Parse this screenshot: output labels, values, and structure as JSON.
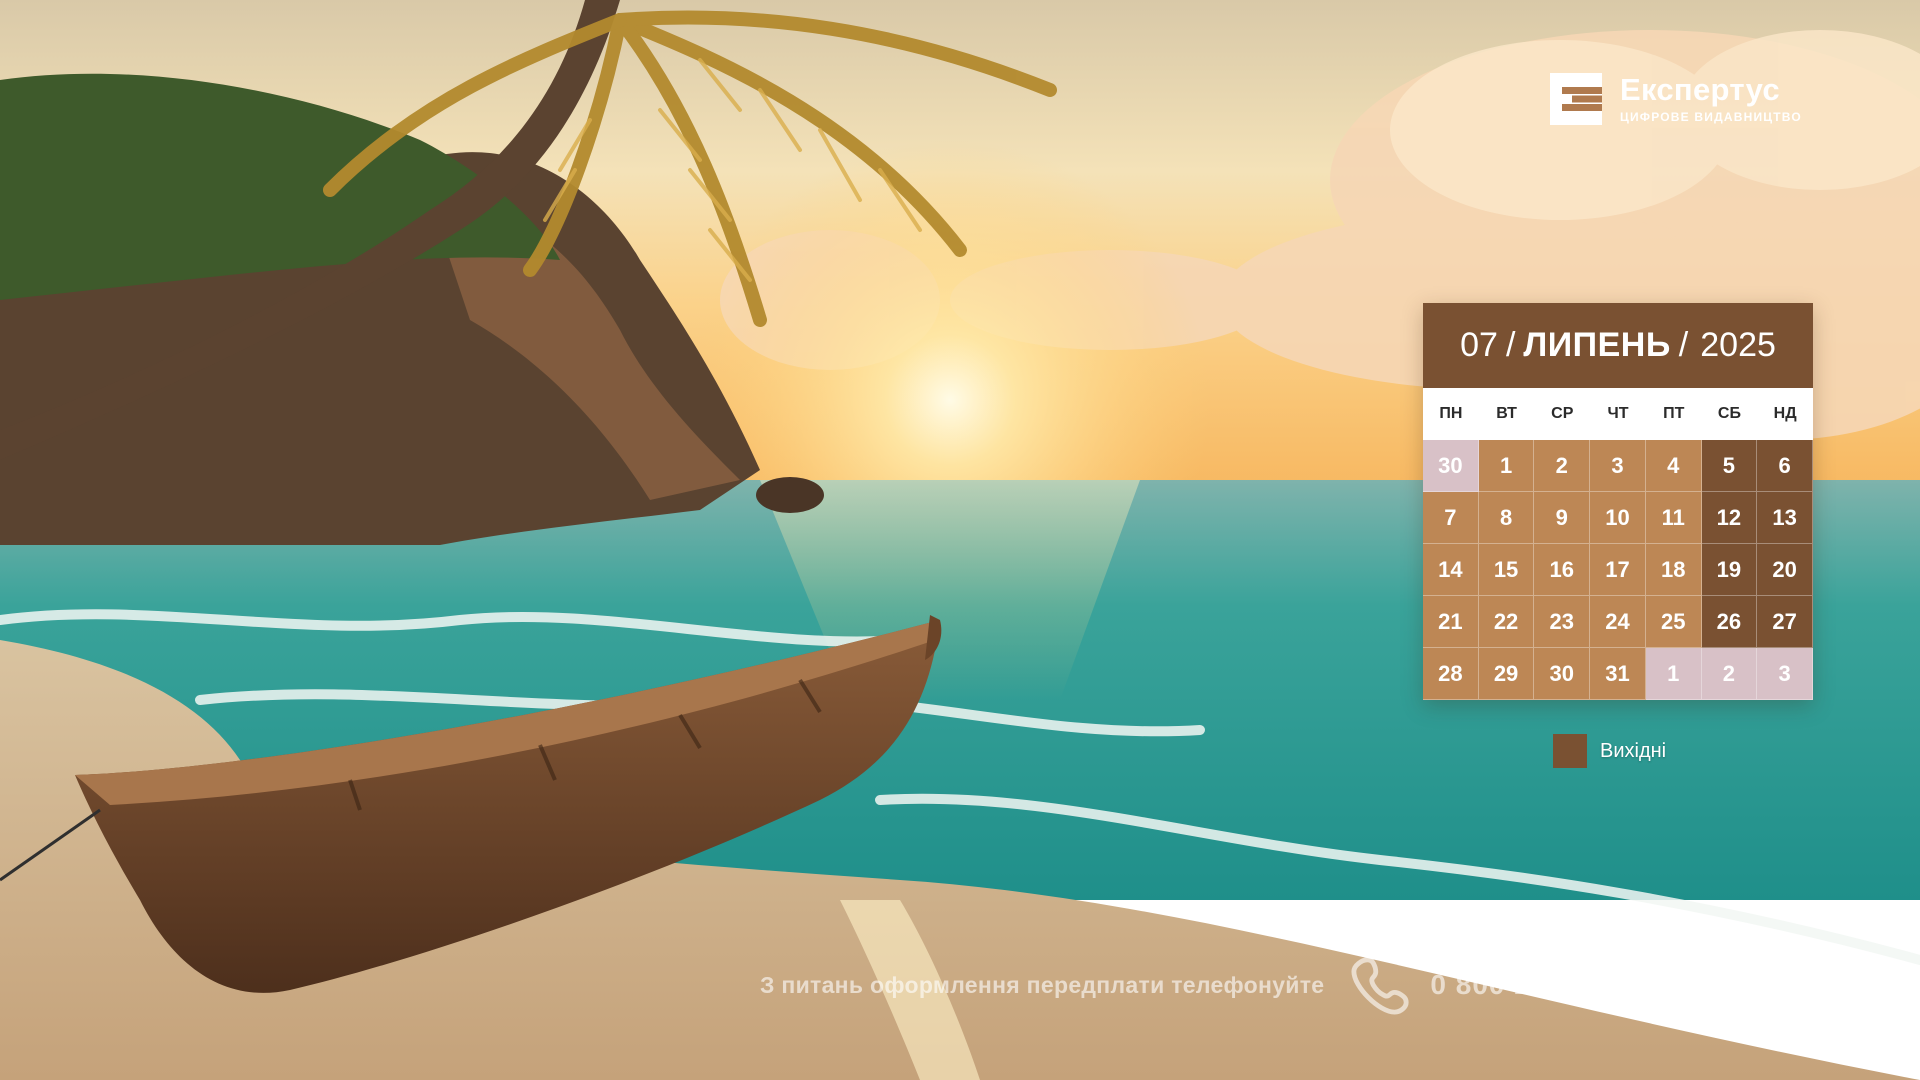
{
  "logo": {
    "name": "Експертус",
    "subtitle": "ЦИФРОВЕ ВИДАВНИЦТВО"
  },
  "calendar": {
    "month_number": "07",
    "separator": "/",
    "month_name": "ЛИПЕНЬ",
    "year": "2025",
    "weekdays": [
      "ПН",
      "ВТ",
      "СР",
      "ЧТ",
      "ПТ",
      "СБ",
      "НД"
    ],
    "weeks": [
      [
        {
          "day": "30",
          "kind": "other"
        },
        {
          "day": "1",
          "kind": "work"
        },
        {
          "day": "2",
          "kind": "work"
        },
        {
          "day": "3",
          "kind": "work"
        },
        {
          "day": "4",
          "kind": "work"
        },
        {
          "day": "5",
          "kind": "weekend"
        },
        {
          "day": "6",
          "kind": "weekend"
        }
      ],
      [
        {
          "day": "7",
          "kind": "work"
        },
        {
          "day": "8",
          "kind": "work"
        },
        {
          "day": "9",
          "kind": "work"
        },
        {
          "day": "10",
          "kind": "work"
        },
        {
          "day": "11",
          "kind": "work"
        },
        {
          "day": "12",
          "kind": "weekend"
        },
        {
          "day": "13",
          "kind": "weekend"
        }
      ],
      [
        {
          "day": "14",
          "kind": "work"
        },
        {
          "day": "15",
          "kind": "work"
        },
        {
          "day": "16",
          "kind": "work"
        },
        {
          "day": "17",
          "kind": "work"
        },
        {
          "day": "18",
          "kind": "work"
        },
        {
          "day": "19",
          "kind": "weekend"
        },
        {
          "day": "20",
          "kind": "weekend"
        }
      ],
      [
        {
          "day": "21",
          "kind": "work"
        },
        {
          "day": "22",
          "kind": "work"
        },
        {
          "day": "23",
          "kind": "work"
        },
        {
          "day": "24",
          "kind": "work"
        },
        {
          "day": "25",
          "kind": "work"
        },
        {
          "day": "26",
          "kind": "weekend"
        },
        {
          "day": "27",
          "kind": "weekend"
        }
      ],
      [
        {
          "day": "28",
          "kind": "work"
        },
        {
          "day": "29",
          "kind": "work"
        },
        {
          "day": "30",
          "kind": "work"
        },
        {
          "day": "31",
          "kind": "work"
        },
        {
          "day": "1",
          "kind": "other"
        },
        {
          "day": "2",
          "kind": "other"
        },
        {
          "day": "3",
          "kind": "other"
        }
      ]
    ]
  },
  "legend": {
    "label": "Вихідні",
    "color": "#7a5132"
  },
  "footer": {
    "text": "З питань оформлення передплати телефонуйте",
    "phone": "0 800 21 20 12",
    "icon": "phone-icon"
  },
  "colors": {
    "weekend": "#7a5132",
    "workday": "#bd8755",
    "other_month": "#d8c1c7"
  }
}
